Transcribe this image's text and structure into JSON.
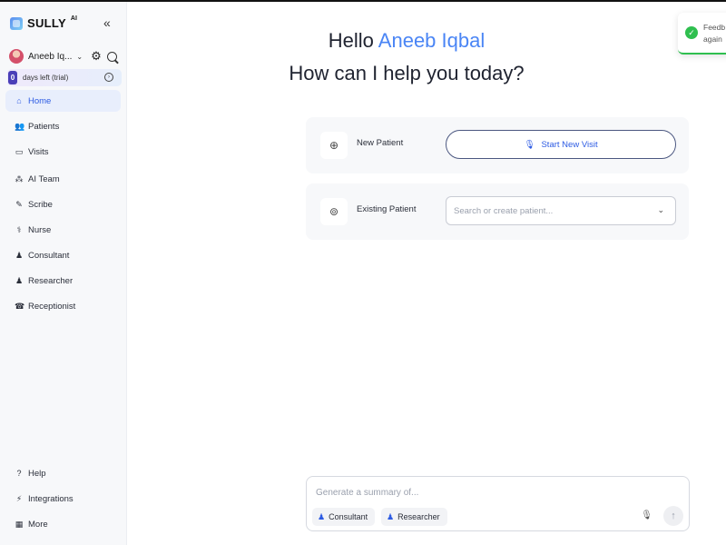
{
  "brand": {
    "name": "SULLY",
    "sup": "AI",
    "collapse_icon": "chevrons-left-icon"
  },
  "user": {
    "name": "Aneeb Iq...",
    "avatar_icon": "avatar"
  },
  "trial": {
    "count": "0",
    "label": "days left (trial)"
  },
  "nav": {
    "items": [
      {
        "label": "Home",
        "icon": "⌂",
        "active": true
      },
      {
        "label": "Patients",
        "icon": "👥"
      },
      {
        "label": "Visits",
        "icon": "▭"
      },
      {
        "label": "AI Team",
        "icon": "⁂"
      },
      {
        "label": "Scribe",
        "icon": "✎"
      },
      {
        "label": "Nurse",
        "icon": "⚕"
      },
      {
        "label": "Consultant",
        "icon": "♟"
      },
      {
        "label": "Researcher",
        "icon": "♟"
      },
      {
        "label": "Receptionist",
        "icon": "☎"
      }
    ],
    "bottom": [
      {
        "label": "Help",
        "icon": "?"
      },
      {
        "label": "Integrations",
        "icon": "⚡"
      },
      {
        "label": "More",
        "icon": "▦"
      }
    ]
  },
  "greeting": {
    "hello": "Hello",
    "user_name": "Aneeb Iqbal",
    "question": "How can I help you today?"
  },
  "new_patient": {
    "title": "New Patient",
    "button_label": "Start New Visit"
  },
  "existing_patient": {
    "title": "Existing Patient",
    "placeholder": "Search or create patient..."
  },
  "composer": {
    "placeholder": "Generate a summary of...",
    "chips": [
      "Consultant",
      "Researcher"
    ]
  },
  "toast": {
    "line1": "Feedb",
    "line2": "again",
    "status_color": "#2fbf4f"
  },
  "colors": {
    "accent": "#2d5be3",
    "name_highlight": "#4a85f5",
    "trial_badge": "#4a3fb8"
  }
}
